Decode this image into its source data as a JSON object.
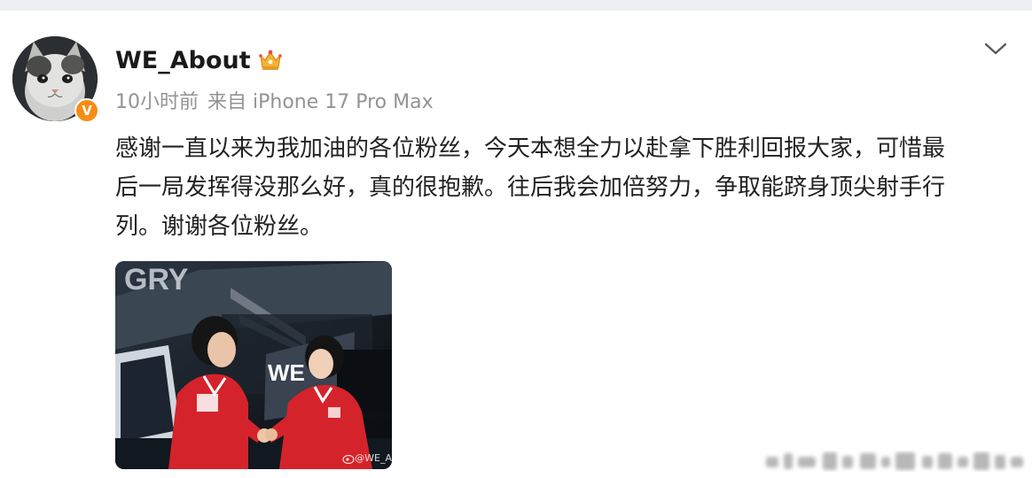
{
  "post": {
    "author": {
      "name": "WE_About",
      "verified_badge": "V",
      "avatar_icon": "cat-avatar",
      "member_icon": "crown-icon"
    },
    "meta": {
      "time": "10小时前",
      "source": "来自 iPhone 17 Pro Max"
    },
    "menu_icon": "chevron-down-icon",
    "text_lines": [
      "感谢一直以来为我加油的各位粉丝，今天本想全力以赴拿下胜利回报大家，可惜最",
      "后一局发挥得没那么好，真的很抱歉。往后我会加倍努力，争取能跻身顶尖射手行",
      "列。谢谢各位粉丝。"
    ],
    "image": {
      "watermark": "@WE_A"
    }
  },
  "colors": {
    "background": "#ffffff",
    "top_strip": "#eff0f4",
    "meta_text": "#939393",
    "verified_orange": "#f78c14",
    "jersey_red": "#d5232b"
  }
}
